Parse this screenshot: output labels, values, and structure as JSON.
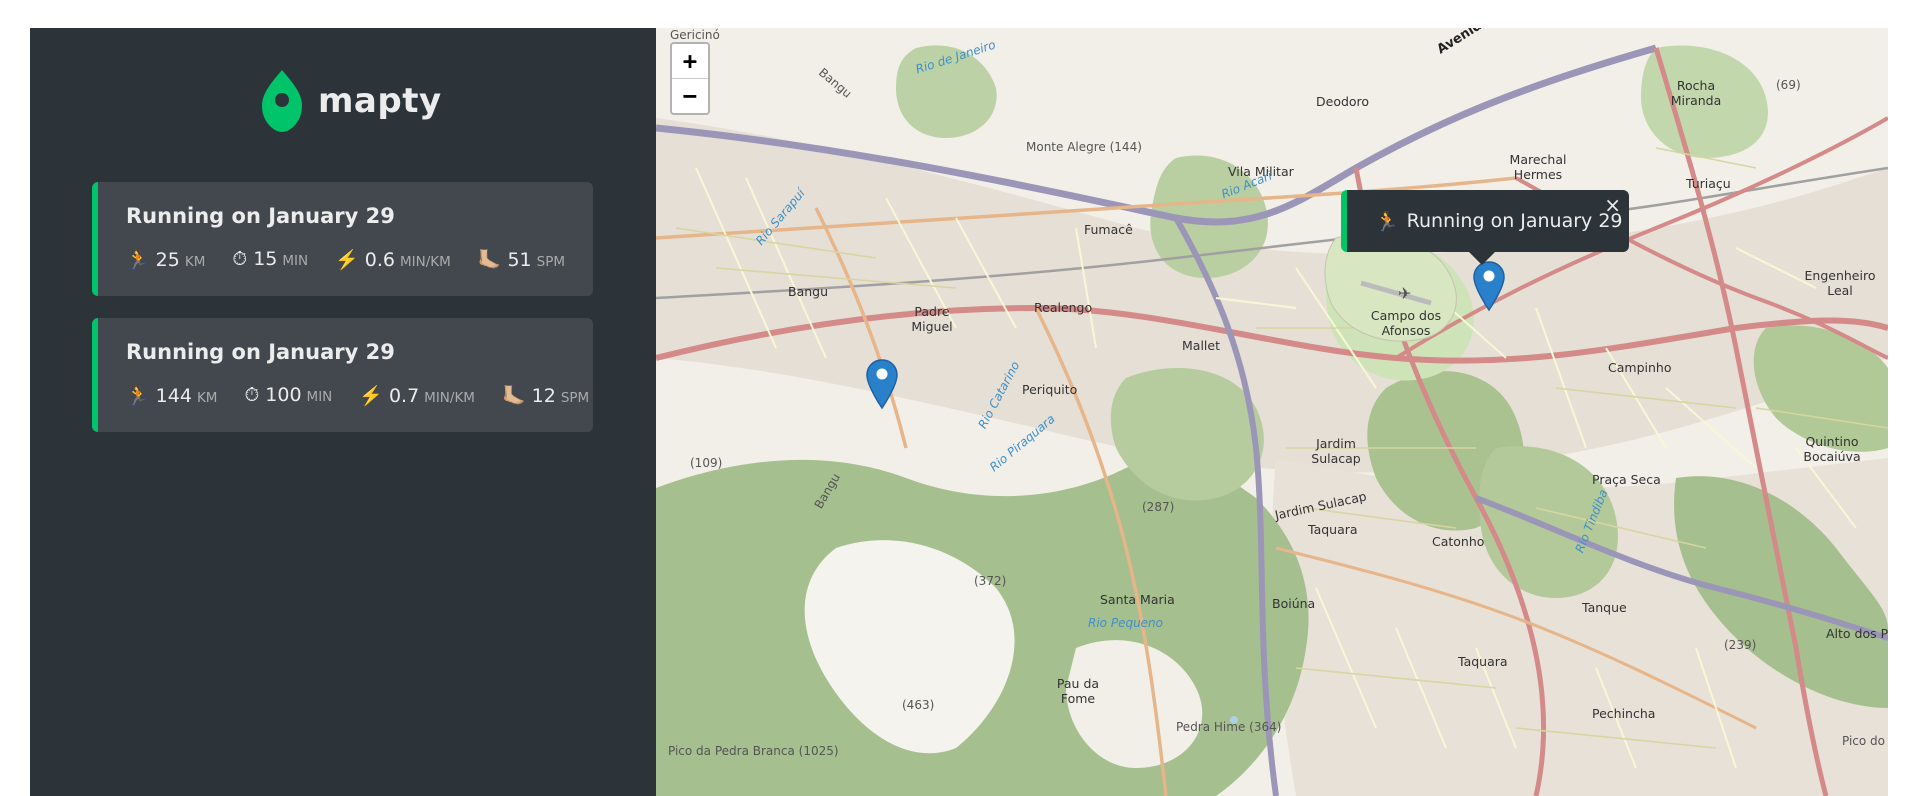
{
  "app": {
    "name": "mapty",
    "accent": "#00c46a"
  },
  "workouts": [
    {
      "title": "Running on January 29",
      "distance": {
        "icon": "🏃",
        "value": "25",
        "unit": "km"
      },
      "duration": {
        "icon": "⏱",
        "value": "15",
        "unit": "min"
      },
      "pace": {
        "icon": "⚡️",
        "value": "0.6",
        "unit": "min/km"
      },
      "cadence": {
        "icon": "🦶🏼",
        "value": "51",
        "unit": "spm"
      }
    },
    {
      "title": "Running on January 29",
      "distance": {
        "icon": "🏃",
        "value": "144",
        "unit": "km"
      },
      "duration": {
        "icon": "⏱",
        "value": "100",
        "unit": "min"
      },
      "pace": {
        "icon": "⚡️",
        "value": "0.7",
        "unit": "min/km"
      },
      "cadence": {
        "icon": "🦶🏼",
        "value": "12",
        "unit": "spm"
      }
    }
  ],
  "map": {
    "zoom_in": "+",
    "zoom_out": "−",
    "popup": {
      "icon": "🏃",
      "text": "Running on January 29",
      "close": "×"
    },
    "labels": {
      "gericino": "Gericinó",
      "rio_de_janeiro": "Rio de Janeiro",
      "bangu_n": "Bangu",
      "monte_alegre": "Monte Alegre (144)",
      "avenida": "Avenida",
      "deodoro": "Deodoro",
      "vila_militar": "Vila Militar",
      "rio_acari": "Rio Acari",
      "marechal": "Marechal Hermes",
      "rocha_miranda": "Rocha Miranda",
      "turiacu": "Turiaçu",
      "n69": "(69)",
      "rio_sarapui": "Rio Sarapuí",
      "fumace": "Fumacê",
      "bangu": "Bangu",
      "padre_miguel": "Padre Miguel",
      "realengo": "Realengo",
      "campo_afonsos": "Campo dos Afonsos",
      "engenheiro_leal": "Engenheiro Leal",
      "magalhaes": "Mallet",
      "campinho": "Campinho",
      "periquito": "Periquito",
      "rio_catarino": "Rio Catarino",
      "rio_piraquara": "Rio Piraquara",
      "jardim_sulacap": "Jardim Sulacap",
      "n109": "(109)",
      "quintino": "Quintino Bocaiúva",
      "praca_seca": "Praça Seca",
      "jardim_sulacap_road": "Jardim Sulacap",
      "taquara_road": "Taquara",
      "catonho": "Catonho",
      "rio_tindiba": "Rio Tindiba",
      "bangu_s": "Bangu",
      "n287": "(287)",
      "n372": "(372)",
      "santa_maria": "Santa Maria",
      "rio_pequeno": "Rio Pequeno",
      "boiuna": "Boiúna",
      "tanque": "Tanque",
      "alto_dos": "Alto dos Pe",
      "n239": "(239)",
      "taquara": "Taquara",
      "pau_da_fome": "Pau da Fome",
      "n463": "(463)",
      "pedra_hime": "Pedra Hime (364)",
      "pechincha": "Pechincha",
      "pedra_branca": "Pico da Pedra Branca (1025)",
      "pico_do": "Pico do"
    }
  }
}
